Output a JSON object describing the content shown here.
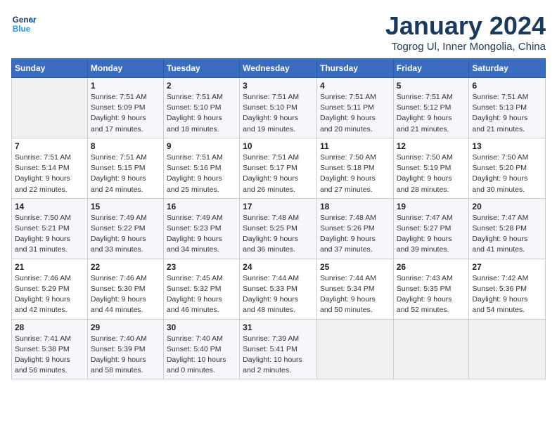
{
  "header": {
    "logo_line1": "General",
    "logo_line2": "Blue",
    "title": "January 2024",
    "subtitle": "Togrog Ul, Inner Mongolia, China"
  },
  "calendar": {
    "days_of_week": [
      "Sunday",
      "Monday",
      "Tuesday",
      "Wednesday",
      "Thursday",
      "Friday",
      "Saturday"
    ],
    "weeks": [
      [
        {
          "day": "",
          "info": ""
        },
        {
          "day": "1",
          "info": "Sunrise: 7:51 AM\nSunset: 5:09 PM\nDaylight: 9 hours\nand 17 minutes."
        },
        {
          "day": "2",
          "info": "Sunrise: 7:51 AM\nSunset: 5:10 PM\nDaylight: 9 hours\nand 18 minutes."
        },
        {
          "day": "3",
          "info": "Sunrise: 7:51 AM\nSunset: 5:10 PM\nDaylight: 9 hours\nand 19 minutes."
        },
        {
          "day": "4",
          "info": "Sunrise: 7:51 AM\nSunset: 5:11 PM\nDaylight: 9 hours\nand 20 minutes."
        },
        {
          "day": "5",
          "info": "Sunrise: 7:51 AM\nSunset: 5:12 PM\nDaylight: 9 hours\nand 21 minutes."
        },
        {
          "day": "6",
          "info": "Sunrise: 7:51 AM\nSunset: 5:13 PM\nDaylight: 9 hours\nand 21 minutes."
        }
      ],
      [
        {
          "day": "7",
          "info": "Sunrise: 7:51 AM\nSunset: 5:14 PM\nDaylight: 9 hours\nand 22 minutes."
        },
        {
          "day": "8",
          "info": "Sunrise: 7:51 AM\nSunset: 5:15 PM\nDaylight: 9 hours\nand 24 minutes."
        },
        {
          "day": "9",
          "info": "Sunrise: 7:51 AM\nSunset: 5:16 PM\nDaylight: 9 hours\nand 25 minutes."
        },
        {
          "day": "10",
          "info": "Sunrise: 7:51 AM\nSunset: 5:17 PM\nDaylight: 9 hours\nand 26 minutes."
        },
        {
          "day": "11",
          "info": "Sunrise: 7:50 AM\nSunset: 5:18 PM\nDaylight: 9 hours\nand 27 minutes."
        },
        {
          "day": "12",
          "info": "Sunrise: 7:50 AM\nSunset: 5:19 PM\nDaylight: 9 hours\nand 28 minutes."
        },
        {
          "day": "13",
          "info": "Sunrise: 7:50 AM\nSunset: 5:20 PM\nDaylight: 9 hours\nand 30 minutes."
        }
      ],
      [
        {
          "day": "14",
          "info": "Sunrise: 7:50 AM\nSunset: 5:21 PM\nDaylight: 9 hours\nand 31 minutes."
        },
        {
          "day": "15",
          "info": "Sunrise: 7:49 AM\nSunset: 5:22 PM\nDaylight: 9 hours\nand 33 minutes."
        },
        {
          "day": "16",
          "info": "Sunrise: 7:49 AM\nSunset: 5:23 PM\nDaylight: 9 hours\nand 34 minutes."
        },
        {
          "day": "17",
          "info": "Sunrise: 7:48 AM\nSunset: 5:25 PM\nDaylight: 9 hours\nand 36 minutes."
        },
        {
          "day": "18",
          "info": "Sunrise: 7:48 AM\nSunset: 5:26 PM\nDaylight: 9 hours\nand 37 minutes."
        },
        {
          "day": "19",
          "info": "Sunrise: 7:47 AM\nSunset: 5:27 PM\nDaylight: 9 hours\nand 39 minutes."
        },
        {
          "day": "20",
          "info": "Sunrise: 7:47 AM\nSunset: 5:28 PM\nDaylight: 9 hours\nand 41 minutes."
        }
      ],
      [
        {
          "day": "21",
          "info": "Sunrise: 7:46 AM\nSunset: 5:29 PM\nDaylight: 9 hours\nand 42 minutes."
        },
        {
          "day": "22",
          "info": "Sunrise: 7:46 AM\nSunset: 5:30 PM\nDaylight: 9 hours\nand 44 minutes."
        },
        {
          "day": "23",
          "info": "Sunrise: 7:45 AM\nSunset: 5:32 PM\nDaylight: 9 hours\nand 46 minutes."
        },
        {
          "day": "24",
          "info": "Sunrise: 7:44 AM\nSunset: 5:33 PM\nDaylight: 9 hours\nand 48 minutes."
        },
        {
          "day": "25",
          "info": "Sunrise: 7:44 AM\nSunset: 5:34 PM\nDaylight: 9 hours\nand 50 minutes."
        },
        {
          "day": "26",
          "info": "Sunrise: 7:43 AM\nSunset: 5:35 PM\nDaylight: 9 hours\nand 52 minutes."
        },
        {
          "day": "27",
          "info": "Sunrise: 7:42 AM\nSunset: 5:36 PM\nDaylight: 9 hours\nand 54 minutes."
        }
      ],
      [
        {
          "day": "28",
          "info": "Sunrise: 7:41 AM\nSunset: 5:38 PM\nDaylight: 9 hours\nand 56 minutes."
        },
        {
          "day": "29",
          "info": "Sunrise: 7:40 AM\nSunset: 5:39 PM\nDaylight: 9 hours\nand 58 minutes."
        },
        {
          "day": "30",
          "info": "Sunrise: 7:40 AM\nSunset: 5:40 PM\nDaylight: 10 hours\nand 0 minutes."
        },
        {
          "day": "31",
          "info": "Sunrise: 7:39 AM\nSunset: 5:41 PM\nDaylight: 10 hours\nand 2 minutes."
        },
        {
          "day": "",
          "info": ""
        },
        {
          "day": "",
          "info": ""
        },
        {
          "day": "",
          "info": ""
        }
      ]
    ]
  }
}
